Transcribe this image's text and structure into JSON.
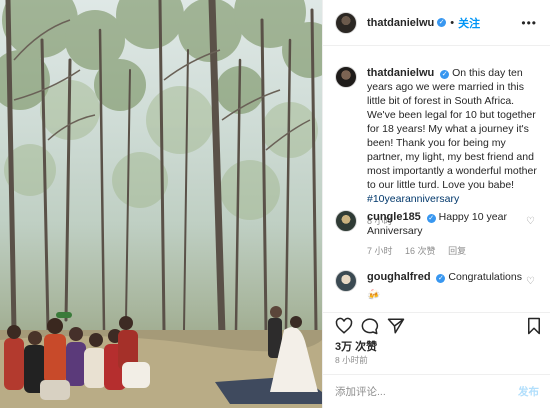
{
  "post": {
    "username": "thatdanielwu",
    "follow_label": "关注",
    "more_label": "•••",
    "caption_text": "On this day ten years ago we were married in this little bit of forest in South Africa. We've been legal for 10 but together for 18 years! My what a journey it's been! Thank you for being my partner, my light, my best friend and most importantly a wonderful mother to our little turd. Love you babe! ",
    "hashtag": "#10yearanniversary",
    "caption_time": "8 小时"
  },
  "comments": [
    {
      "username": "cungle185",
      "text": "Happy 10 year Anniversary",
      "time": "7 小时",
      "likes": "16 次赞",
      "reply": "回复"
    },
    {
      "username": "goughalfred",
      "text": "Congratulations",
      "emoji": "🍻"
    }
  ],
  "actions": {
    "like_icon": "heart-icon",
    "comment_icon": "comment-icon",
    "share_icon": "share-icon",
    "save_icon": "bookmark-icon"
  },
  "likes_count": "3万 次赞",
  "post_time": "8 小时前",
  "add_comment": {
    "placeholder": "添加评论...",
    "publish_label": "发布"
  },
  "colors": {
    "accent": "#0095f6",
    "verified": "#3897f0",
    "border": "#efefef"
  }
}
